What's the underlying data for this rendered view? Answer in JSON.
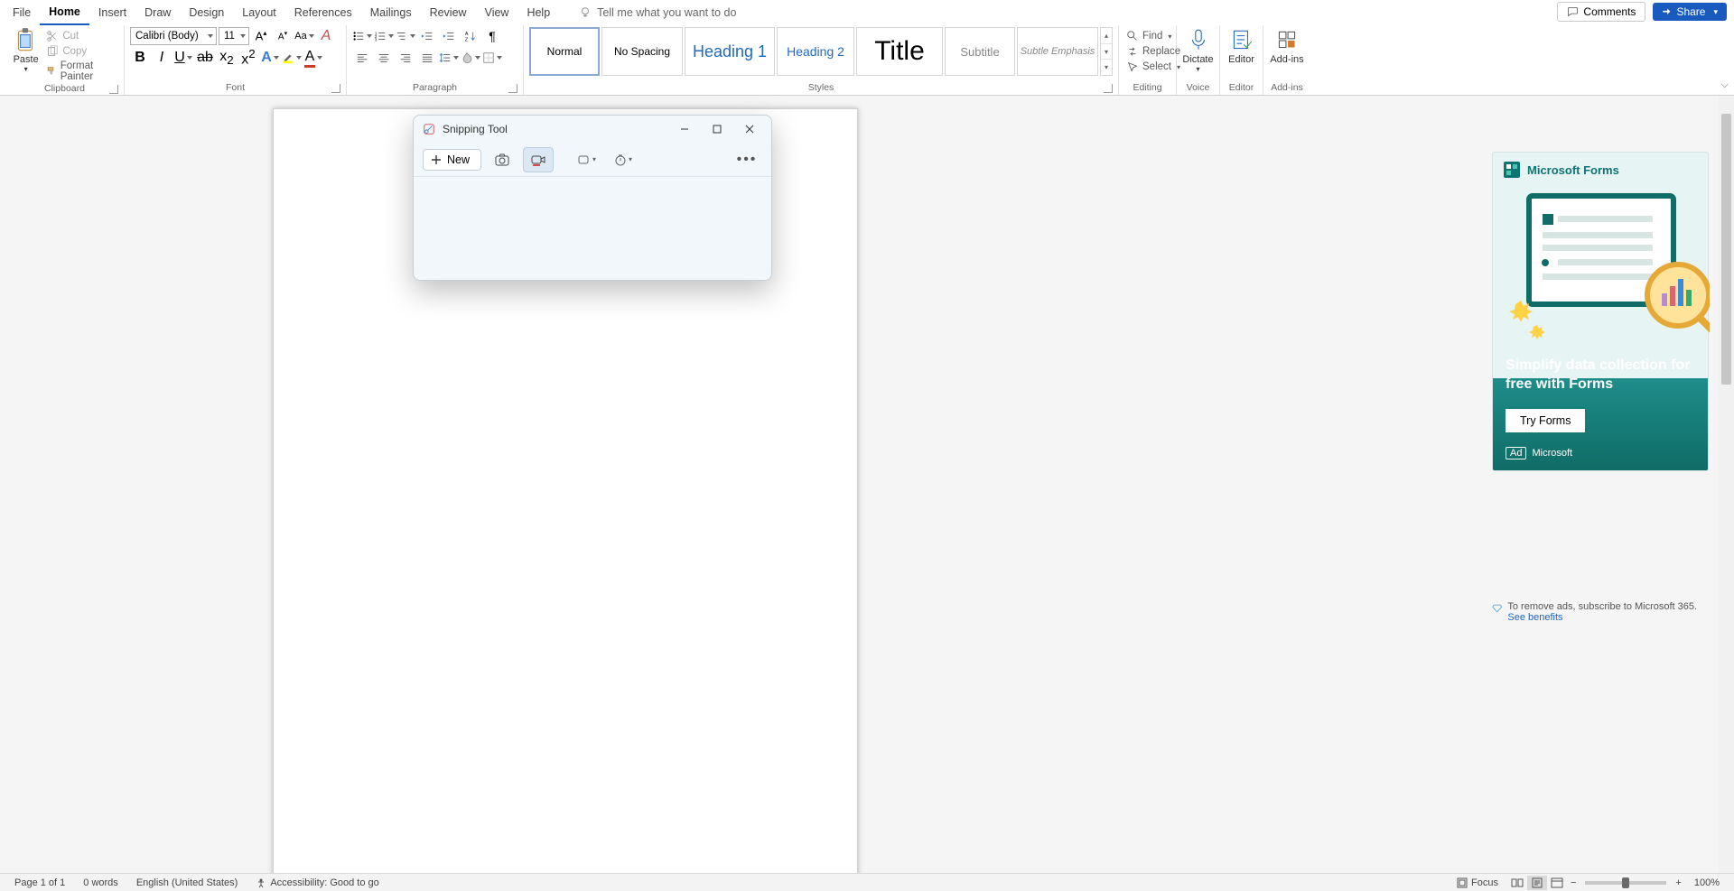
{
  "tabs": [
    "File",
    "Home",
    "Insert",
    "Draw",
    "Design",
    "Layout",
    "References",
    "Mailings",
    "Review",
    "View",
    "Help"
  ],
  "activeTab": "Home",
  "tellMe": "Tell me what you want to do",
  "topRight": {
    "comments": "Comments",
    "share": "Share"
  },
  "clipboard": {
    "paste": "Paste",
    "cut": "Cut",
    "copy": "Copy",
    "formatPainter": "Format Painter",
    "group": "Clipboard"
  },
  "font": {
    "name": "Calibri (Body)",
    "size": "11",
    "group": "Font"
  },
  "paragraph": {
    "group": "Paragraph"
  },
  "stylesGroup": {
    "group": "Styles",
    "items": [
      "Normal",
      "No Spacing",
      "Heading 1",
      "Heading 2",
      "Title",
      "Subtitle",
      "Subtle Emphasis"
    ]
  },
  "editing": {
    "find": "Find",
    "replace": "Replace",
    "select": "Select",
    "group": "Editing"
  },
  "voice": {
    "dictate": "Dictate",
    "group": "Voice"
  },
  "editor": {
    "editor": "Editor",
    "group": "Editor"
  },
  "addins": {
    "addins": "Add-ins",
    "group": "Add-ins"
  },
  "snip": {
    "title": "Snipping Tool",
    "new": "New"
  },
  "ad": {
    "title": "Microsoft Forms",
    "headline": "Simplify data collection for free with Forms",
    "button": "Try Forms",
    "badge": "Ad",
    "sponsor": "Microsoft",
    "note": "To remove ads, subscribe to Microsoft 365.",
    "link": "See benefits"
  },
  "status": {
    "page": "Page 1 of 1",
    "words": "0 words",
    "lang": "English (United States)",
    "a11y": "Accessibility: Good to go",
    "focus": "Focus",
    "zoom": "100%"
  }
}
